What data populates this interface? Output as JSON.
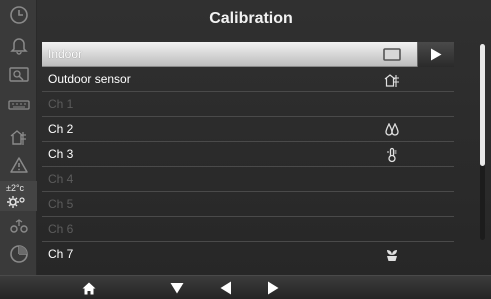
{
  "header": {
    "title": "Calibration"
  },
  "sidebar": {
    "items": [
      {
        "icon": "clock-icon"
      },
      {
        "icon": "bell-icon"
      },
      {
        "icon": "history-icon"
      },
      {
        "icon": "keyboard-icon"
      },
      {
        "icon": "weather-station-icon"
      },
      {
        "icon": "warning-icon"
      },
      {
        "icon": "calibration-settings-icon",
        "label": "±2°c",
        "active": true
      },
      {
        "icon": "wireless-sensors-icon"
      },
      {
        "icon": "pie-chart-icon"
      }
    ]
  },
  "list": {
    "rows": [
      {
        "label": "Indoor",
        "state": "selected",
        "icon": "indoor-display-icon"
      },
      {
        "label": "Outdoor sensor",
        "state": "enabled",
        "icon": "outdoor-sensor-icon"
      },
      {
        "label": "Ch 1",
        "state": "disabled"
      },
      {
        "label": "Ch 2",
        "state": "enabled",
        "icon": "water-drops-icon"
      },
      {
        "label": "Ch 3",
        "state": "enabled",
        "icon": "thermometer-icon"
      },
      {
        "label": "Ch 4",
        "state": "disabled"
      },
      {
        "label": "Ch 5",
        "state": "disabled"
      },
      {
        "label": "Ch 6",
        "state": "disabled"
      },
      {
        "label": "Ch 7",
        "state": "enabled",
        "icon": "plant-pot-icon"
      }
    ]
  },
  "scroll": {
    "visible_fraction": 0.62,
    "position": 0
  },
  "bottom_nav": [
    "home-icon",
    "down-arrow-icon",
    "left-arrow-icon",
    "right-arrow-icon"
  ]
}
